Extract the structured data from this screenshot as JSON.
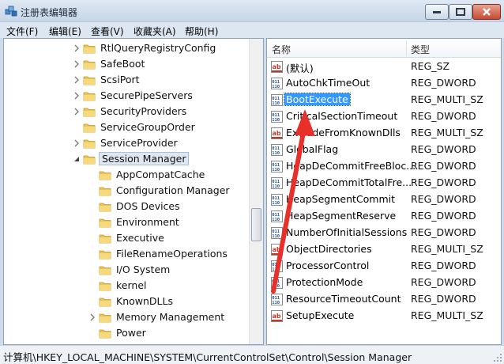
{
  "window": {
    "title": "注册表编辑器",
    "accent_color": "#3399ff",
    "annotation_color": "#e8302a"
  },
  "menu": [
    {
      "label": "文件(F)"
    },
    {
      "label": "编辑(E)"
    },
    {
      "label": "查看(V)"
    },
    {
      "label": "收藏夹(A)"
    },
    {
      "label": "帮助(H)"
    }
  ],
  "tree": {
    "items": [
      {
        "label": "RtlQueryRegistryConfig",
        "expandable": true,
        "expanded": false,
        "level": 0
      },
      {
        "label": "SafeBoot",
        "expandable": true,
        "expanded": false,
        "level": 0
      },
      {
        "label": "ScsiPort",
        "expandable": true,
        "expanded": false,
        "level": 0
      },
      {
        "label": "SecurePipeServers",
        "expandable": true,
        "expanded": false,
        "level": 0
      },
      {
        "label": "SecurityProviders",
        "expandable": true,
        "expanded": false,
        "level": 0
      },
      {
        "label": "ServiceGroupOrder",
        "expandable": false,
        "expanded": false,
        "level": 0
      },
      {
        "label": "ServiceProvider",
        "expandable": true,
        "expanded": false,
        "level": 0
      },
      {
        "label": "Session Manager",
        "expandable": true,
        "expanded": true,
        "level": 0,
        "selected": true
      },
      {
        "label": "AppCompatCache",
        "expandable": false,
        "expanded": false,
        "level": 1
      },
      {
        "label": "Configuration Manager",
        "expandable": false,
        "expanded": false,
        "level": 1
      },
      {
        "label": "DOS Devices",
        "expandable": false,
        "expanded": false,
        "level": 1
      },
      {
        "label": "Environment",
        "expandable": false,
        "expanded": false,
        "level": 1
      },
      {
        "label": "Executive",
        "expandable": false,
        "expanded": false,
        "level": 1
      },
      {
        "label": "FileRenameOperations",
        "expandable": false,
        "expanded": false,
        "level": 1
      },
      {
        "label": "I/O System",
        "expandable": false,
        "expanded": false,
        "level": 1
      },
      {
        "label": "kernel",
        "expandable": false,
        "expanded": false,
        "level": 1
      },
      {
        "label": "KnownDLLs",
        "expandable": false,
        "expanded": false,
        "level": 1
      },
      {
        "label": "Memory Management",
        "expandable": true,
        "expanded": false,
        "level": 1
      },
      {
        "label": "Power",
        "expandable": false,
        "expanded": false,
        "level": 1
      }
    ]
  },
  "values": {
    "headers": {
      "name": "名称",
      "type": "类型"
    },
    "rows": [
      {
        "name": "(默认)",
        "type": "REG_SZ",
        "icon": "string-value-icon"
      },
      {
        "name": "AutoChkTimeOut",
        "type": "REG_DWORD",
        "icon": "binary-value-icon"
      },
      {
        "name": "BootExecute",
        "type": "REG_MULTI_SZ",
        "icon": "binary-value-icon",
        "selected": true
      },
      {
        "name": "CriticalSectionTimeout",
        "type": "REG_DWORD",
        "icon": "binary-value-icon"
      },
      {
        "name": "ExcludeFromKnownDlls",
        "type": "REG_MULTI_SZ",
        "icon": "string-value-icon"
      },
      {
        "name": "GlobalFlag",
        "type": "REG_DWORD",
        "icon": "binary-value-icon"
      },
      {
        "name": "HeapDeCommitFreeBloc...",
        "type": "REG_DWORD",
        "icon": "binary-value-icon"
      },
      {
        "name": "HeapDeCommitTotalFre...",
        "type": "REG_DWORD",
        "icon": "binary-value-icon"
      },
      {
        "name": "HeapSegmentCommit",
        "type": "REG_DWORD",
        "icon": "binary-value-icon"
      },
      {
        "name": "HeapSegmentReserve",
        "type": "REG_DWORD",
        "icon": "binary-value-icon"
      },
      {
        "name": "NumberOfInitialSessions",
        "type": "REG_DWORD",
        "icon": "binary-value-icon"
      },
      {
        "name": "ObjectDirectories",
        "type": "REG_MULTI_SZ",
        "icon": "string-value-icon"
      },
      {
        "name": "ProcessorControl",
        "type": "REG_DWORD",
        "icon": "binary-value-icon"
      },
      {
        "name": "ProtectionMode",
        "type": "REG_DWORD",
        "icon": "binary-value-icon"
      },
      {
        "name": "ResourceTimeoutCount",
        "type": "REG_DWORD",
        "icon": "binary-value-icon"
      },
      {
        "name": "SetupExecute",
        "type": "REG_MULTI_SZ",
        "icon": "string-value-icon"
      }
    ]
  },
  "status": {
    "path": "计算机\\HKEY_LOCAL_MACHINE\\SYSTEM\\CurrentControlSet\\Control\\Session Manager"
  }
}
